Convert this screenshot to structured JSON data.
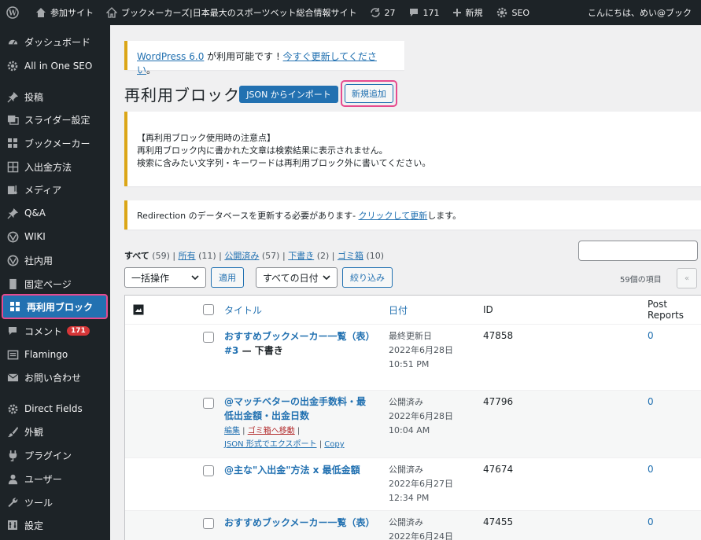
{
  "colors": {
    "adminbar_bg": "#1d2327",
    "accent_blue": "#2271b1",
    "highlight_pink": "#e64a8e",
    "notice_yellow": "#dba617",
    "badge_red": "#d63638"
  },
  "adminbar": {
    "wp_logo_icon": "wordpress-icon",
    "site_name": "参加サイト",
    "site_title": "ブックメーカーズ|日本最大のスポーツベット総合情報サイト",
    "updates_count": "27",
    "comments_count": "171",
    "new_label": "新規",
    "seo_label": "SEO",
    "greeting": "こんにちは、めい@ブック"
  },
  "sidebar": {
    "items": [
      {
        "label": "ダッシュボード",
        "icon": "dashboard-icon"
      },
      {
        "label": "All in One SEO",
        "icon": "seo-gear-icon"
      },
      {
        "label": "投稿",
        "icon": "pin-icon"
      },
      {
        "label": "スライダー設定",
        "icon": "slider-icon"
      },
      {
        "label": "ブックメーカー",
        "icon": "grid-icon"
      },
      {
        "label": "入出金方法",
        "icon": "table-icon"
      },
      {
        "label": "メディア",
        "icon": "media-icon"
      },
      {
        "label": "Q&A",
        "icon": "pin-icon"
      },
      {
        "label": "WIKI",
        "icon": "wiki-icon"
      },
      {
        "label": "社内用",
        "icon": "wiki-icon"
      },
      {
        "label": "固定ページ",
        "icon": "page-icon"
      },
      {
        "label": "再利用ブロック",
        "icon": "blocks-icon"
      },
      {
        "label": "コメント",
        "icon": "comment-icon",
        "badge": "171"
      },
      {
        "label": "Flamingo",
        "icon": "flamingo-icon"
      },
      {
        "label": "お問い合わせ",
        "icon": "mail-icon"
      },
      {
        "label": "Direct Fields",
        "icon": "gear-icon"
      },
      {
        "label": "外観",
        "icon": "brush-icon"
      },
      {
        "label": "プラグイン",
        "icon": "plugin-icon"
      },
      {
        "label": "ユーザー",
        "icon": "user-icon"
      },
      {
        "label": "ツール",
        "icon": "wrench-icon"
      },
      {
        "label": "設定",
        "icon": "settings-icon"
      }
    ]
  },
  "notice_update": {
    "link_version": "WordPress 6.0",
    "text": " が利用可能です ! ",
    "link_update": "今すぐ更新してください",
    "suffix": "。"
  },
  "page": {
    "title": "再利用ブロック",
    "import_button": "JSON からインポート",
    "add_new_button": "新規追加"
  },
  "notice_info": {
    "line1": "【再利用ブロック使用時の注意点】",
    "line2": "再利用ブロック内に書かれた文章は検索結果に表示されません。",
    "line3": "検索に含みたい文字列・キーワードは再利用ブロック外に書いてください。"
  },
  "notice_redirection": {
    "prefix": "Redirection のデータベースを更新する必要があります- ",
    "link": "クリックして更新",
    "suffix": "します。"
  },
  "filters": {
    "all_label": "すべて",
    "all_count": "(59)",
    "mine_label": "所有",
    "mine_count": "(11)",
    "published_label": "公開済み",
    "published_count": "(57)",
    "draft_label": "下書き",
    "draft_count": "(2)",
    "trash_label": "ゴミ箱",
    "trash_count": "(10)",
    "sep": " | "
  },
  "toolbar": {
    "bulk_action": "一括操作",
    "apply": "適用",
    "all_dates": "すべての日付",
    "filter": "絞り込み",
    "items_count": "59個の項目",
    "first_page": "«"
  },
  "table": {
    "columns": {
      "title": "タイトル",
      "date": "日付",
      "id": "ID",
      "reports": "Post Reports"
    },
    "rows": [
      {
        "title": "おすすめブックメーカー一覧（表）#3",
        "state": " — 下書き",
        "date_status": "最終更新日",
        "date": "2022年6月28日",
        "time": "10:51 PM",
        "id": "47858",
        "reports": "0"
      },
      {
        "title": "@マッチベターの出金手数料・最低出金額・出金日数",
        "state": "",
        "date_status": "公開済み",
        "date": "2022年6月28日",
        "time": "10:04 AM",
        "id": "47796",
        "reports": "0",
        "actions": {
          "edit": "編集",
          "trash": "ゴミ箱へ移動",
          "export": "JSON 形式でエクスポート",
          "copy": "Copy",
          "sep": " | "
        }
      },
      {
        "title": "@主な\"入出金\"方法 x 最低金額",
        "state": "",
        "date_status": "公開済み",
        "date": "2022年6月27日",
        "time": "12:34 PM",
        "id": "47674",
        "reports": "0"
      },
      {
        "title": "おすすめブックメーカー一覧（表）",
        "state": "",
        "date_status": "公開済み",
        "date": "2022年6月24日",
        "time": "",
        "id": "47455",
        "reports": "0"
      }
    ]
  }
}
